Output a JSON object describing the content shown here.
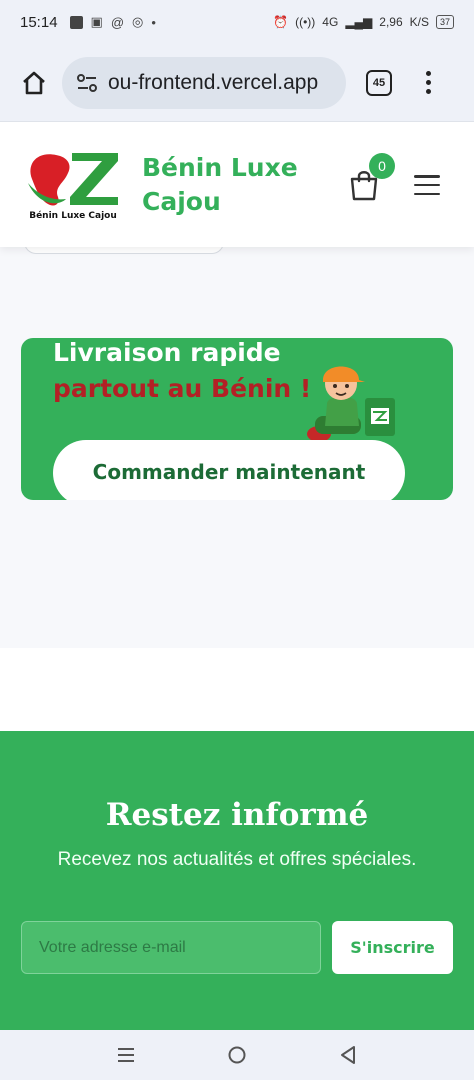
{
  "status_bar": {
    "time": "15:14",
    "network": "4G",
    "speed": "2,96",
    "speed_unit": "K/S",
    "battery": "37"
  },
  "browser": {
    "url": "ou-frontend.vercel.app",
    "tab_count": "45"
  },
  "header": {
    "logo_caption": "Bénin Luxe Cajou",
    "brand_name": "Bénin Luxe Cajou",
    "cart_count": "0"
  },
  "promo": {
    "line1": "Livraison rapide",
    "line2": "partout au Bénin !",
    "cta_label": "Commander maintenant"
  },
  "newsletter": {
    "title": "Restez informé",
    "subtitle": "Recevez nos actualités et offres spéciales.",
    "email_placeholder": "Votre adresse e-mail",
    "subscribe_label": "S'inscrire"
  },
  "colors": {
    "brand_green": "#34b05a",
    "brand_red": "#b32025",
    "dark_green": "#1c6b36",
    "page_bg": "#f7f8fb"
  },
  "icons": {
    "home": "home-icon",
    "site_settings": "tune-icon",
    "cart": "shopping-bag-icon",
    "menu": "hamburger-menu-icon",
    "nav_recents": "recent-apps-icon",
    "nav_home": "circle-home-icon",
    "nav_back": "triangle-back-icon"
  }
}
